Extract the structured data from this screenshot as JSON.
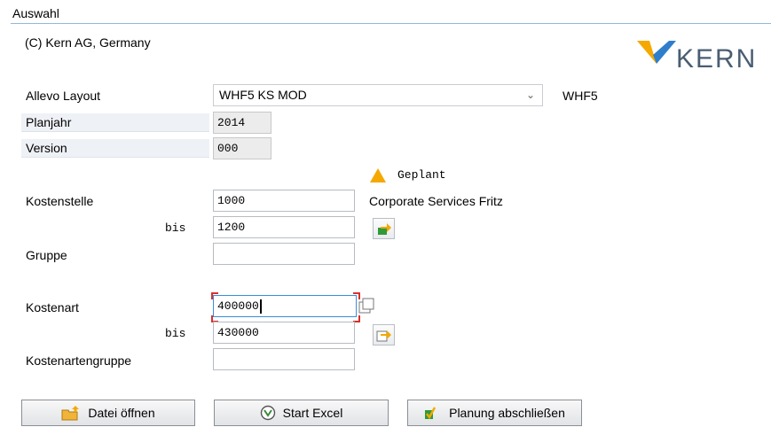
{
  "window": {
    "tab_title": "Auswahl"
  },
  "header": {
    "copyright": "(C) Kern AG, Germany",
    "logo_text": "KERN"
  },
  "form": {
    "layout_label": "Allevo Layout",
    "layout_value": "WHF5 KS MOD",
    "layout_code": "WHF5",
    "planjahr_label": "Planjahr",
    "planjahr_value": "2014",
    "version_label": "Version",
    "version_value": "000",
    "status_text": "Geplant",
    "kostenstelle_label": "Kostenstelle",
    "kostenstelle_from": "1000",
    "kostenstelle_desc": "Corporate Services Fritz",
    "bis_label": "bis",
    "kostenstelle_to": "1200",
    "gruppe_label": "Gruppe",
    "gruppe_value": "",
    "kostenart_label": "Kostenart",
    "kostenart_from": "400000",
    "kostenart_to": "430000",
    "kostenartengruppe_label": "Kostenartengruppe",
    "kostenartengruppe_value": ""
  },
  "buttons": {
    "open_file": "Datei öffnen",
    "start_excel": "Start Excel",
    "finish_planning": "Planung abschließen"
  },
  "colors": {
    "accent_orange": "#f5a800",
    "focus_blue": "#3a8ed8",
    "focus_corner": "#d9302b"
  }
}
